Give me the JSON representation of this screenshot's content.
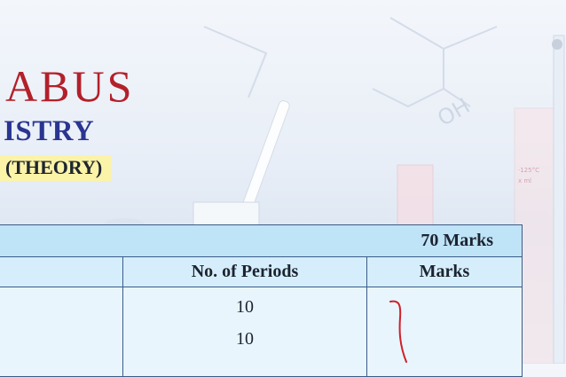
{
  "header": {
    "title": "ABUS",
    "subtitle": "ISTRY",
    "badge": "(THEORY)"
  },
  "table": {
    "total_marks": "70 Marks",
    "columns": [
      "No. of Periods",
      "Marks"
    ],
    "periods": [
      "10",
      "10"
    ]
  },
  "colors": {
    "title": "#b3202a",
    "subtitle": "#2a3591",
    "badge_bg": "#fbf3a8",
    "table_head_bg": "#bfe3f7",
    "brace": "#d0202a"
  }
}
